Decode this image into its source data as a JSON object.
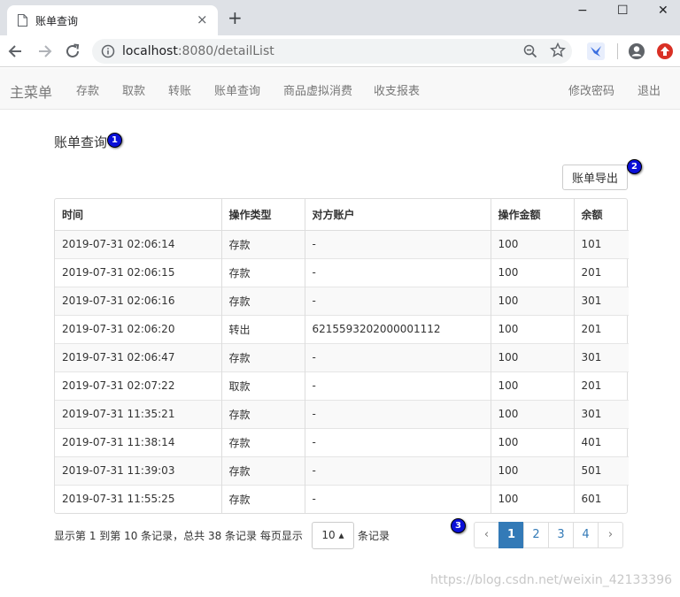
{
  "browser": {
    "tab_title": "账单查询",
    "tab_close": "×",
    "new_tab": "+",
    "url_host": "localhost",
    "url_rest": ":8080/detailList",
    "window_controls": {
      "minimize": "−",
      "maximize": "☐",
      "close": "✕"
    }
  },
  "navbar": {
    "brand": "主菜单",
    "items": [
      "存款",
      "取款",
      "转账",
      "账单查询",
      "商品虚拟消费",
      "收支报表"
    ],
    "right_items": [
      "修改密码",
      "退出"
    ]
  },
  "page": {
    "title": "账单查询",
    "export_label": "账单导出",
    "annotations": [
      "1",
      "2",
      "3"
    ]
  },
  "table": {
    "headers": [
      "时间",
      "操作类型",
      "对方账户",
      "操作金额",
      "余额"
    ],
    "rows": [
      [
        "2019-07-31 02:06:14",
        "存款",
        "-",
        "100",
        "101"
      ],
      [
        "2019-07-31 02:06:15",
        "存款",
        "-",
        "100",
        "201"
      ],
      [
        "2019-07-31 02:06:16",
        "存款",
        "-",
        "100",
        "301"
      ],
      [
        "2019-07-31 02:06:20",
        "转出",
        "6215593202000001112",
        "100",
        "201"
      ],
      [
        "2019-07-31 02:06:47",
        "存款",
        "-",
        "100",
        "301"
      ],
      [
        "2019-07-31 02:07:22",
        "取款",
        "-",
        "100",
        "201"
      ],
      [
        "2019-07-31 11:35:21",
        "存款",
        "-",
        "100",
        "301"
      ],
      [
        "2019-07-31 11:38:14",
        "存款",
        "-",
        "100",
        "401"
      ],
      [
        "2019-07-31 11:39:03",
        "存款",
        "-",
        "100",
        "501"
      ],
      [
        "2019-07-31 11:55:25",
        "存款",
        "-",
        "100",
        "601"
      ]
    ]
  },
  "pager": {
    "info": "显示第 1 到第 10 条记录，总共 38 条记录 每页显示",
    "page_size": "10",
    "page_size_caret": "▴",
    "suffix": "条记录",
    "prev": "‹",
    "next": "›",
    "pages": [
      "1",
      "2",
      "3",
      "4"
    ],
    "active_page": "1"
  },
  "watermark": "https://blog.csdn.net/weixin_42133396",
  "colors": {
    "primary": "#337ab7",
    "badge": "#0a0fd8",
    "navbar_bg": "#f8f8f8"
  }
}
